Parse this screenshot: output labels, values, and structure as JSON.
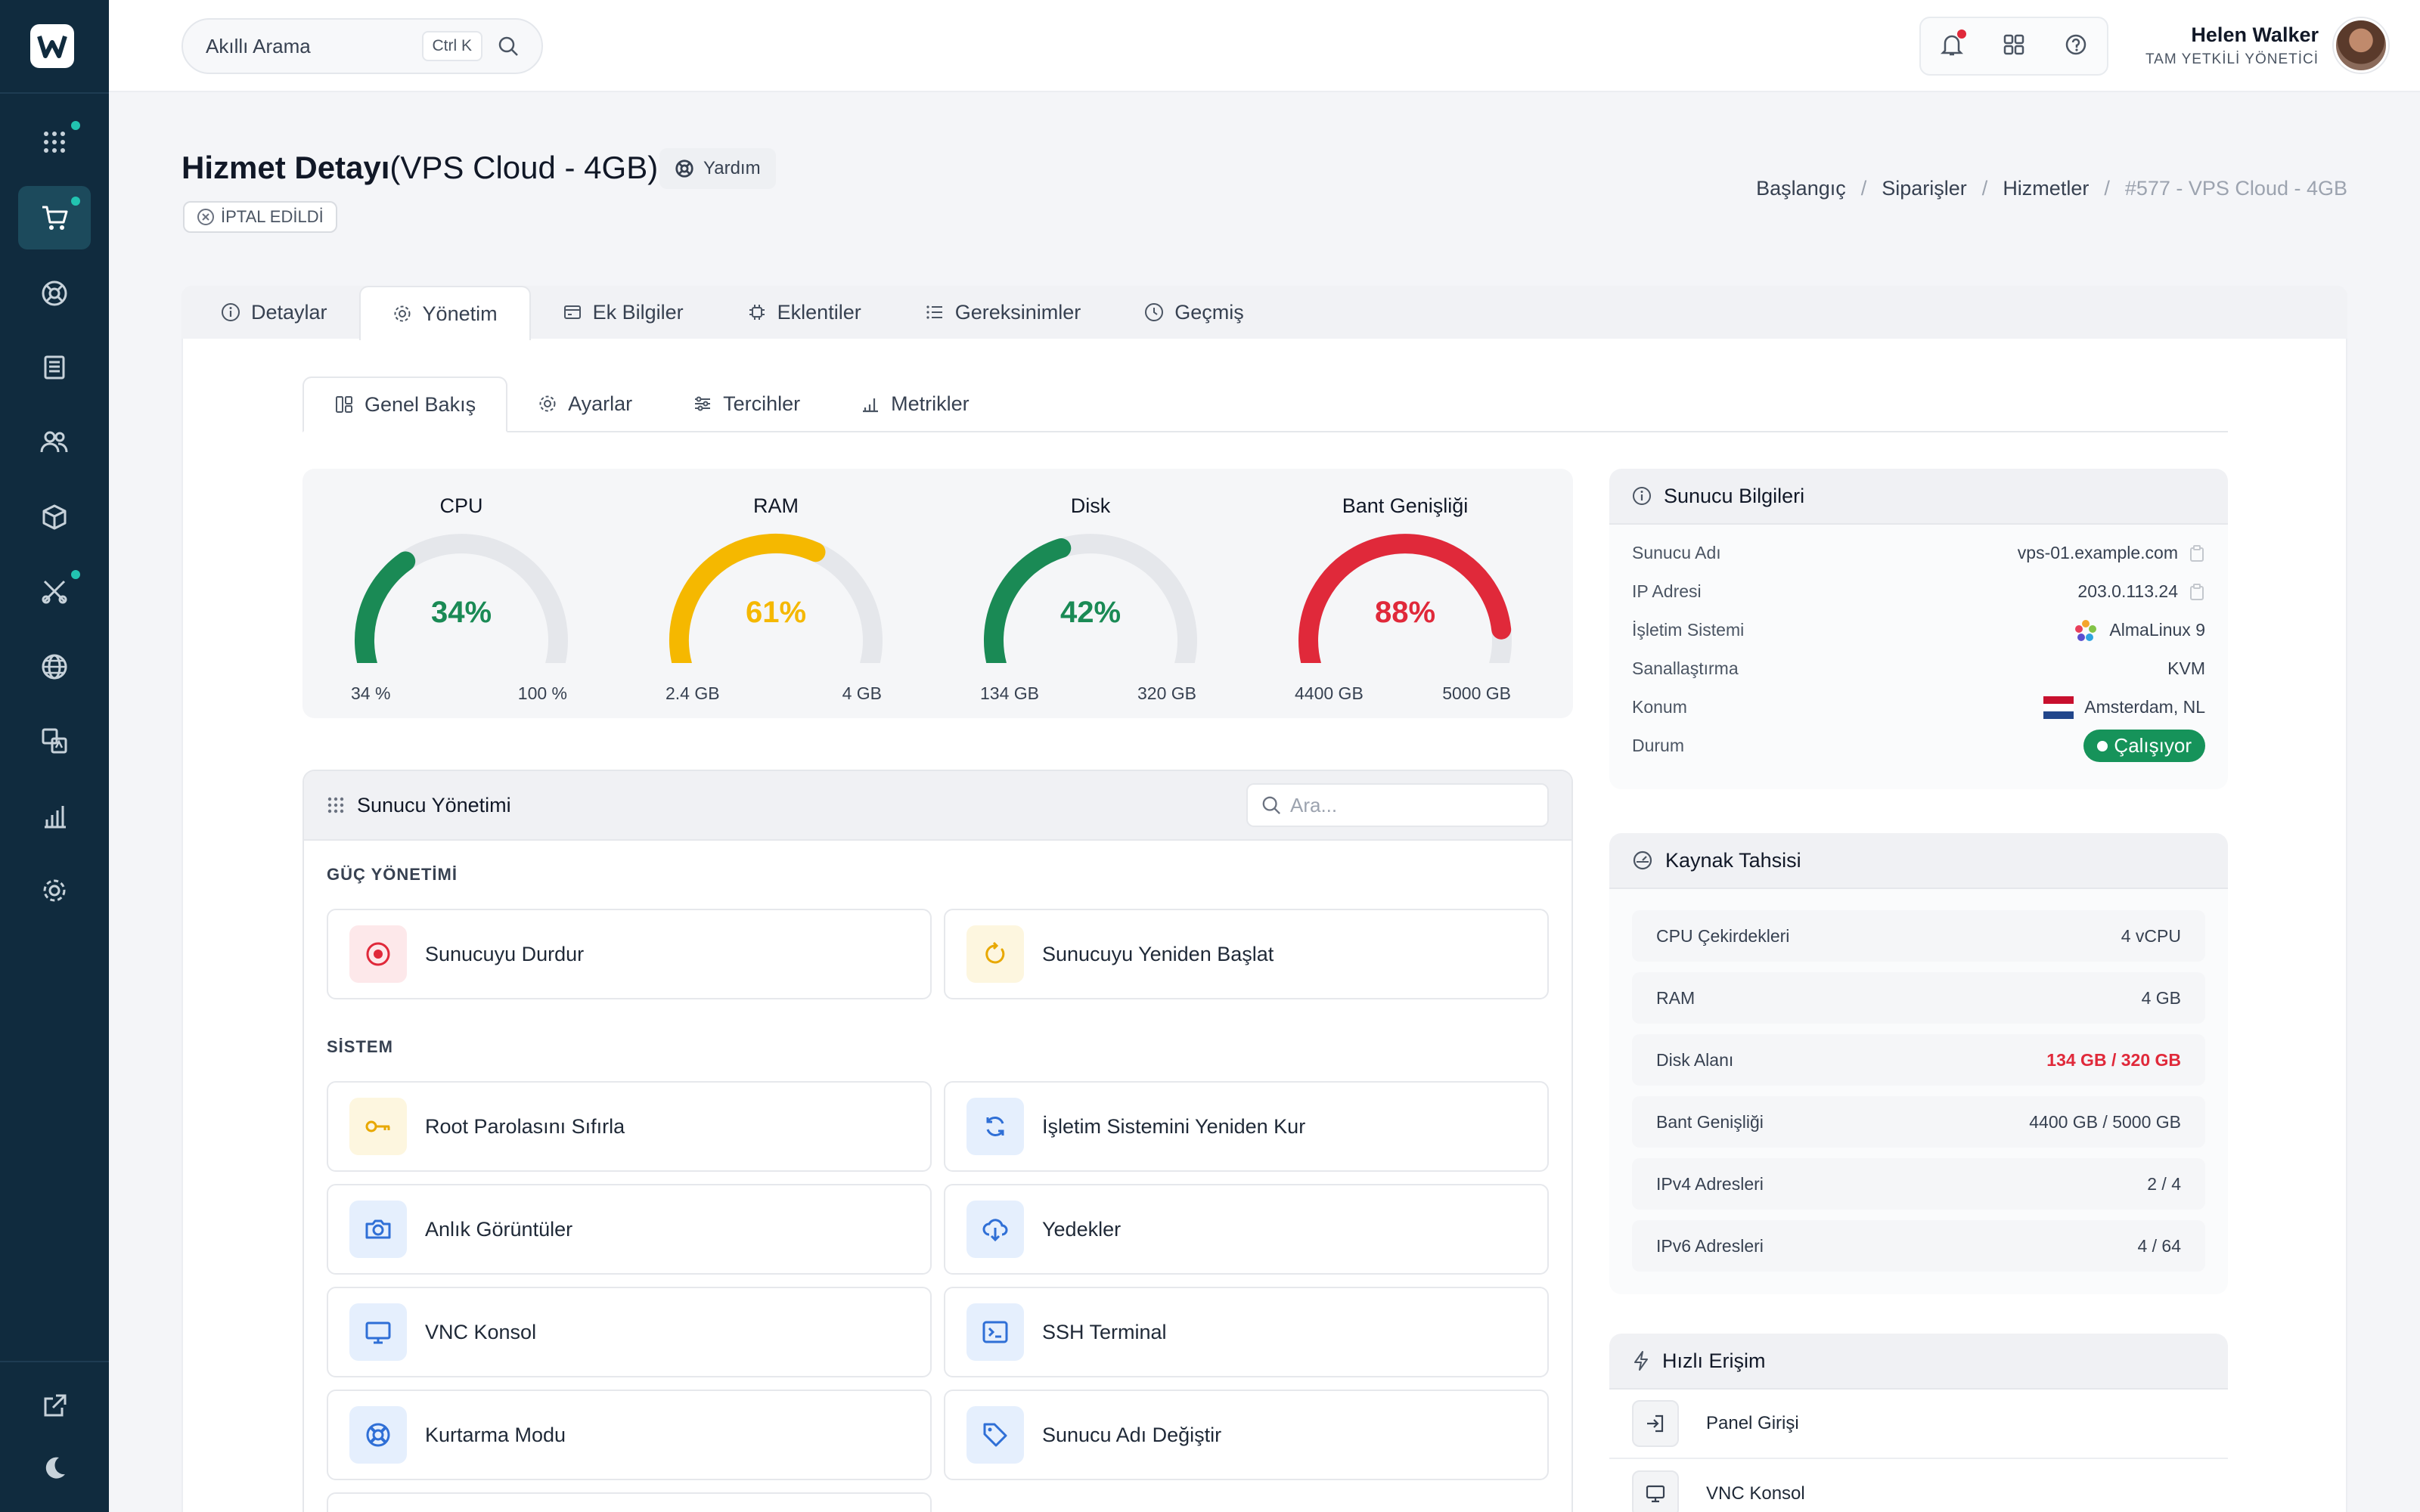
{
  "search": {
    "placeholder": "Akıllı Arama",
    "shortcut": "Ctrl K"
  },
  "user": {
    "name": "Helen Walker",
    "role": "TAM YETKİLİ YÖNETİCİ"
  },
  "page": {
    "title_bold": "Hizmet Detayı",
    "title_rest": "(VPS Cloud - 4GB)",
    "help": "Yardım",
    "status_badge": "İPTAL EDİLDİ"
  },
  "breadcrumb": [
    "Başlangıç",
    "Siparişler",
    "Hizmetler",
    "#577 - VPS Cloud - 4GB"
  ],
  "tabs": [
    "Detaylar",
    "Yönetim",
    "Ek Bilgiler",
    "Eklentiler",
    "Gereksinimler",
    "Geçmiş"
  ],
  "subtabs": [
    "Genel Bakış",
    "Ayarlar",
    "Tercihler",
    "Metrikler"
  ],
  "gauges": [
    {
      "title": "CPU",
      "value": 34,
      "label": "34%",
      "min": "34 %",
      "max": "100 %",
      "color": "#1a8a55"
    },
    {
      "title": "RAM",
      "value": 61,
      "label": "61%",
      "min": "2.4 GB",
      "max": "4 GB",
      "color": "#f5b800"
    },
    {
      "title": "Disk",
      "value": 42,
      "label": "42%",
      "min": "134 GB",
      "max": "320 GB",
      "color": "#1a8a55"
    },
    {
      "title": "Bant Genişliği",
      "value": 88,
      "label": "88%",
      "min": "4400 GB",
      "max": "5000 GB",
      "color": "#e0293a"
    }
  ],
  "management": {
    "title": "Sunucu Yönetimi",
    "search_placeholder": "Ara...",
    "power_title": "GÜÇ YÖNETİMİ",
    "stop": "Sunucuyu Durdur",
    "restart": "Sunucuyu Yeniden Başlat",
    "system_title": "SİSTEM",
    "root": "Root Parolasını Sıfırla",
    "reinstall": "İşletim Sistemini Yeniden Kur",
    "snapshots": "Anlık Görüntüler",
    "backups": "Yedekler",
    "vnc": "VNC Konsol",
    "ssh": "SSH Terminal",
    "rescue": "Kurtarma Modu",
    "hostname": "Sunucu Adı Değiştir"
  },
  "server_info": {
    "title": "Sunucu Bilgileri",
    "rows": [
      {
        "k": "Sunucu Adı",
        "v": "vps-01.example.com"
      },
      {
        "k": "IP Adresi",
        "v": "203.0.113.24"
      },
      {
        "k": "İşletim Sistemi",
        "v": "AlmaLinux 9"
      },
      {
        "k": "Sanallaştırma",
        "v": "KVM"
      },
      {
        "k": "Konum",
        "v": "Amsterdam, NL"
      },
      {
        "k": "Durum",
        "v": "Çalışıyor"
      }
    ]
  },
  "resources": {
    "title": "Kaynak Tahsisi",
    "rows": [
      {
        "k": "CPU Çekirdekleri",
        "v": "4 vCPU"
      },
      {
        "k": "RAM",
        "v": "4 GB"
      },
      {
        "k": "Disk Alanı",
        "v": "134 GB / 320 GB"
      },
      {
        "k": "Bant Genişliği",
        "v": "4400 GB / 5000 GB"
      },
      {
        "k": "IPv4 Adresleri",
        "v": "2 / 4"
      },
      {
        "k": "IPv6 Adresleri",
        "v": "4 / 64"
      }
    ]
  },
  "quick": {
    "title": "Hızlı Erişim",
    "items": [
      "Panel Girişi",
      "VNC Konsol"
    ]
  }
}
